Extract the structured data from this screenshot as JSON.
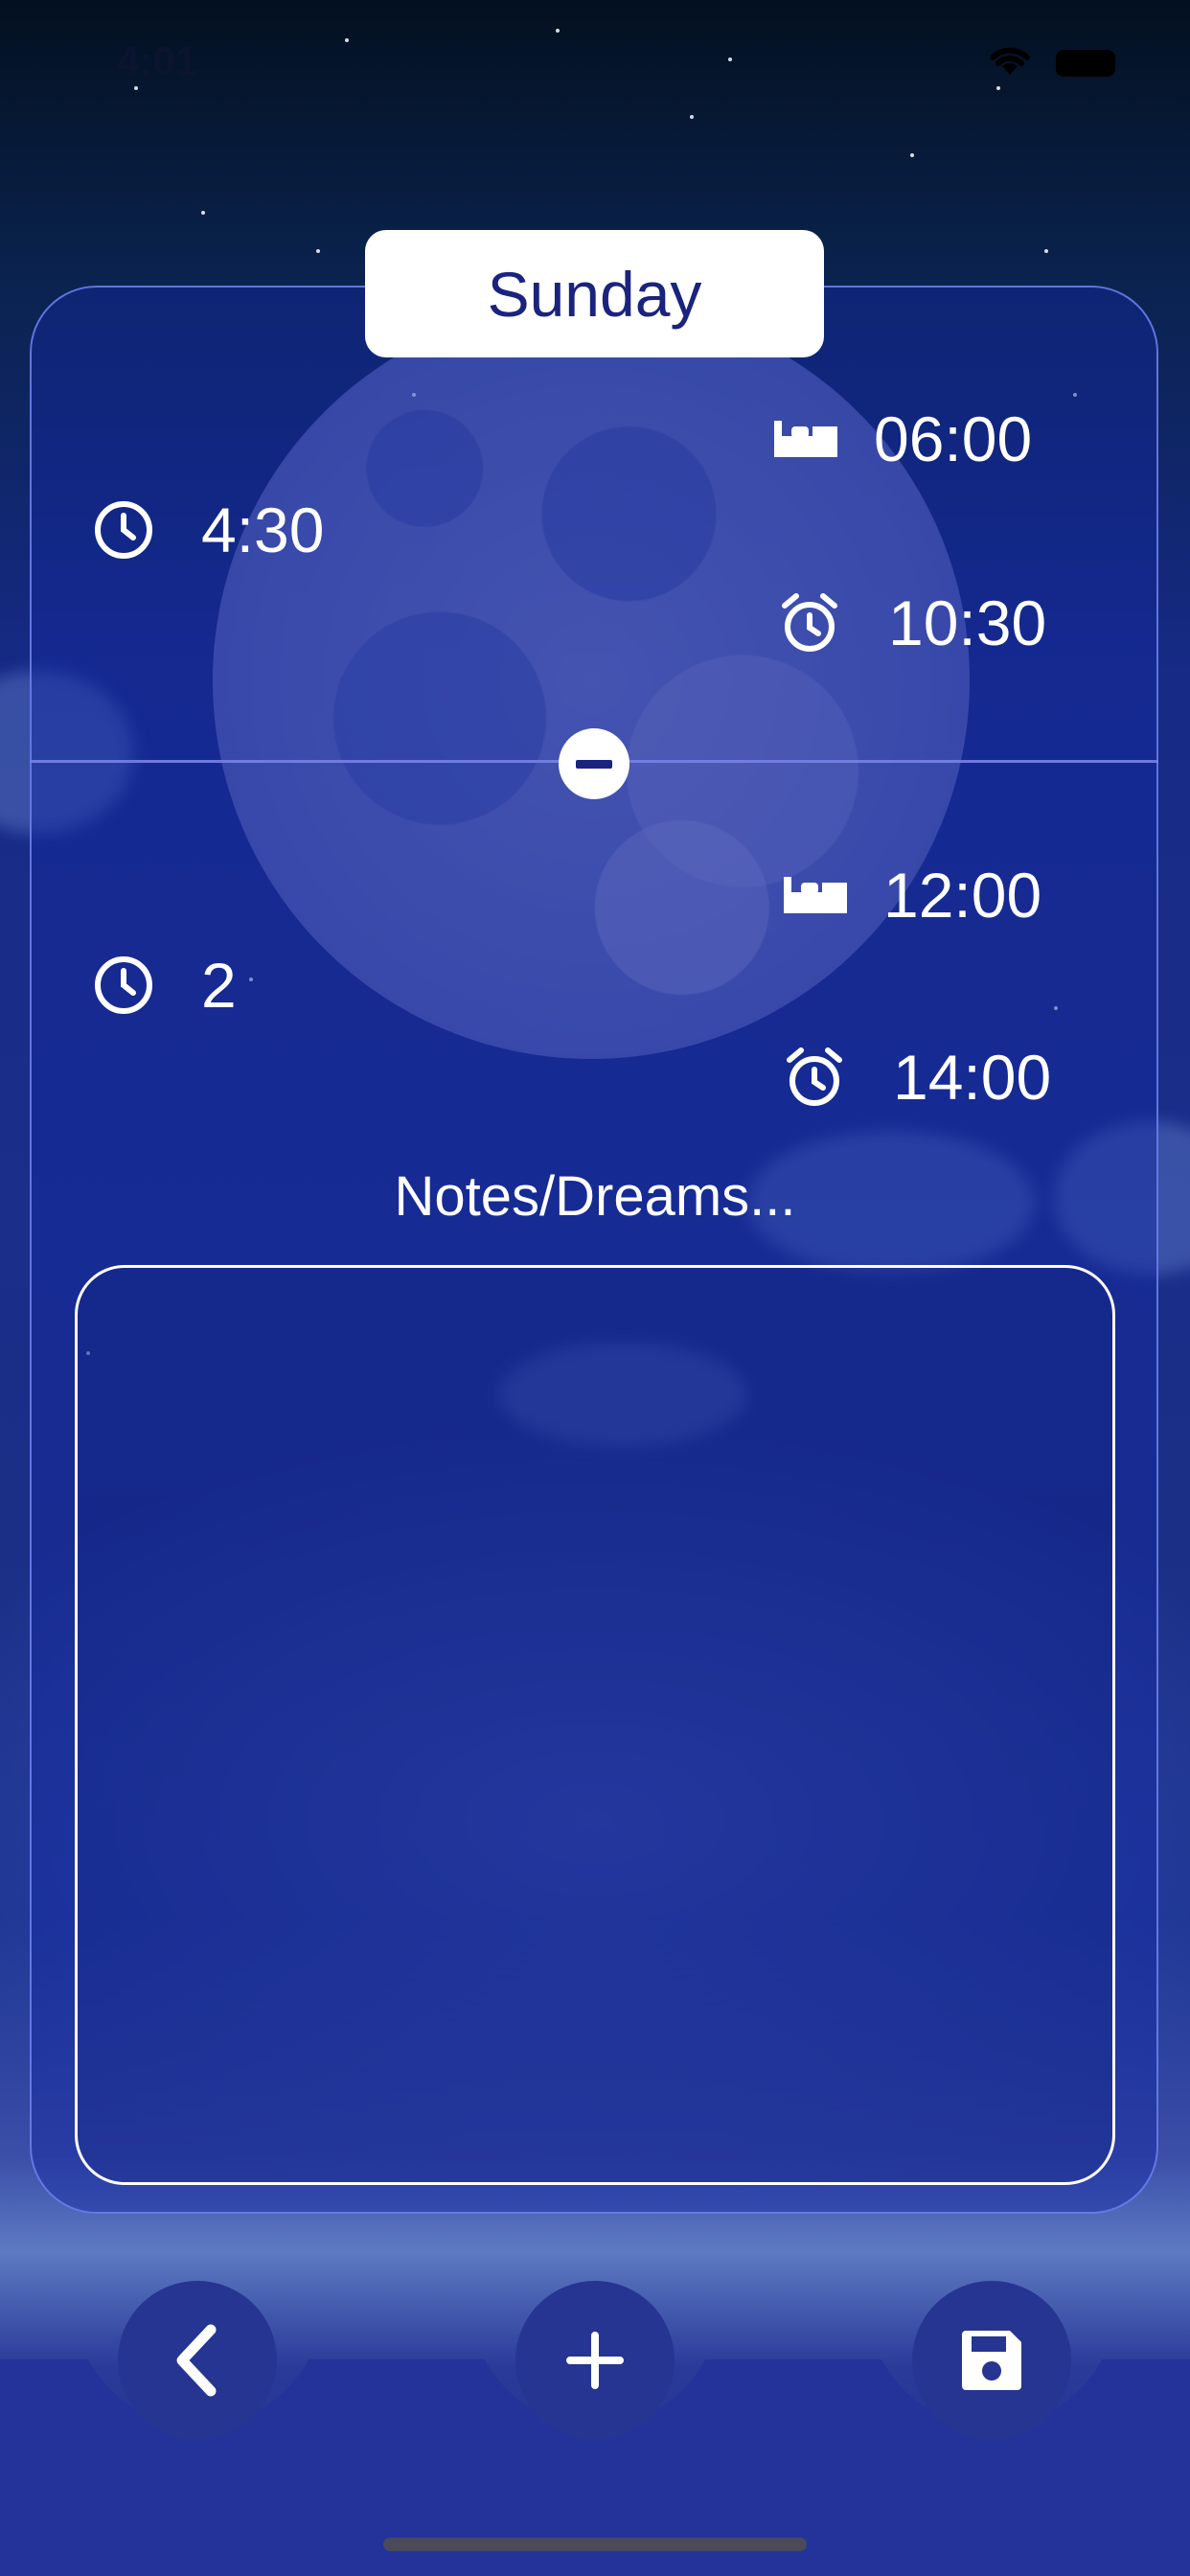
{
  "status_bar": {
    "time": "4:01"
  },
  "day": "Sunday",
  "entries": [
    {
      "duration": "4:30",
      "sleep_time": "06:00",
      "wake_time": "10:30"
    },
    {
      "duration": "2",
      "sleep_time": "12:00",
      "wake_time": "14:00"
    }
  ],
  "notes": {
    "label": "Notes/Dreams...",
    "value": ""
  },
  "icons": {
    "duration": "clock-icon",
    "sleep": "bed-icon",
    "wake": "alarm-clock-icon",
    "remove": "minus-circle-icon",
    "back": "chevron-left-icon",
    "add": "plus-icon",
    "save": "floppy-disk-icon"
  },
  "colors": {
    "accent": "#1a237e",
    "button": "#253591",
    "card_border": "#6e82f0"
  }
}
